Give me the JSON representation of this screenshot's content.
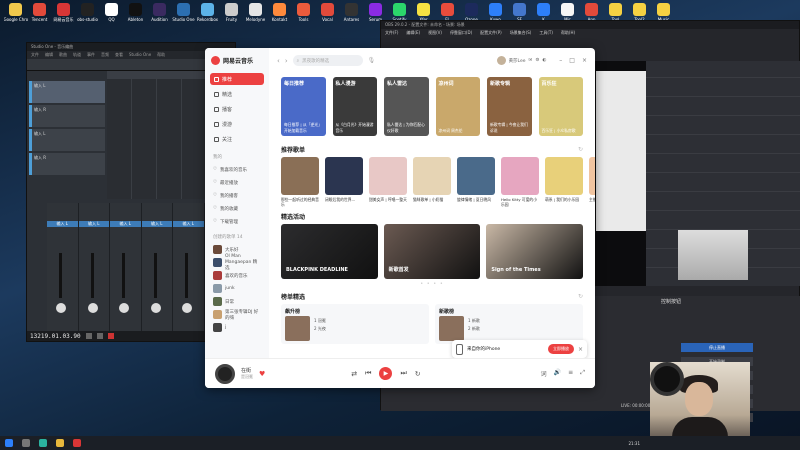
{
  "desktop": {
    "icons": [
      {
        "label": "Google Chrome",
        "color": "#f2c94c"
      },
      {
        "label": "Tencent",
        "color": "#e24a3b"
      },
      {
        "label": "网易云音乐",
        "color": "#d93636"
      },
      {
        "label": "obs-studio",
        "color": "#222222"
      },
      {
        "label": "QQ",
        "color": "#ffffff"
      },
      {
        "label": "Ableton",
        "color": "#111111"
      },
      {
        "label": "Audition",
        "color": "#3a2a60"
      },
      {
        "label": "Studio One",
        "color": "#2c6fb1"
      },
      {
        "label": "Rekordbox",
        "color": "#5cb3e8"
      },
      {
        "label": "Fruity",
        "color": "#cccccc"
      },
      {
        "label": "Melodyne",
        "color": "#e6e6e6"
      },
      {
        "label": "Kontakt",
        "color": "#ff8a3c"
      },
      {
        "label": "Tools",
        "color": "#ec5b3c"
      },
      {
        "label": "Vocal",
        "color": "#e24a3b"
      },
      {
        "label": "Antares",
        "color": "#333333"
      },
      {
        "label": "Serum",
        "color": "#8a2be2"
      },
      {
        "label": "Spotify",
        "color": "#2bd66b"
      },
      {
        "label": "Xfer",
        "color": "#f5e142"
      },
      {
        "label": "FL",
        "color": "#e74c3c"
      },
      {
        "label": "Ozone",
        "color": "#1c2a5c"
      },
      {
        "label": "Kuwo",
        "color": "#2d7ff9"
      },
      {
        "label": "SF",
        "color": "#4477cc"
      },
      {
        "label": "K",
        "color": "#2d7ff9"
      },
      {
        "label": "Mic",
        "color": "#f5f5f5"
      },
      {
        "label": "App",
        "color": "#e24a3b"
      },
      {
        "label": "Tool",
        "color": "#f5d142"
      },
      {
        "label": "Tool2",
        "color": "#f5d142"
      },
      {
        "label": "Music",
        "color": "#f5d142"
      }
    ]
  },
  "daw": {
    "title": "Studio One - 音乐编曲",
    "menu": [
      "文件",
      "编辑",
      "歌曲",
      "轨道",
      "事件",
      "音频",
      "查看",
      "Studio One",
      "帮助"
    ],
    "tracks": [
      "输入 L",
      "输入 R",
      "输入 L",
      "输入 R"
    ],
    "channels": [
      "输入 L",
      "输入 L",
      "输入 L",
      "输入 L",
      "输入 L",
      "输入 L"
    ],
    "timecode": "13219.01.03.90"
  },
  "obs": {
    "title": "OBS 29.0.2 - 配置文件: 未命名 - 场景: 场景",
    "menu": [
      "文件(F)",
      "编辑(E)",
      "视图(V)",
      "停靠窗口(D)",
      "配置文件(P)",
      "场景集合(S)",
      "工具(T)",
      "帮助(H)"
    ],
    "panel_title": "控制按钮",
    "buttons": [
      "停止直播",
      "开始录制",
      "启动虚拟摄像机",
      "工作室模式",
      "设置",
      "退出"
    ],
    "status": "LIVE: 00:00:00"
  },
  "netease": {
    "logo": "网易云音乐",
    "nav": [
      {
        "label": "推荐",
        "active": true
      },
      {
        "label": "精选",
        "active": false
      },
      {
        "label": "播客",
        "active": false
      },
      {
        "label": "漫游",
        "active": false
      },
      {
        "label": "关注",
        "active": false
      }
    ],
    "my_label": "我的",
    "my_items": [
      "我喜欢的音乐",
      "最近播放",
      "我的播客",
      "我的收藏",
      "下载管理"
    ],
    "created_label": "创建的歌单 14",
    "playlists": [
      "大乐好",
      "Ol Man Mangaepan 精选",
      "喜欢的音乐",
      "junk",
      "日常",
      "第三张专辑DJ 好的嗨",
      "j"
    ],
    "search_placeholder": "黑夜歌的精选",
    "user_name": "黄莎Lee",
    "banners": [
      {
        "tag": "每日推荐",
        "sub": "每日推荐 | 从「逆光」开始加载音乐",
        "color": "#4a6ac8"
      },
      {
        "tag": "私人漫游",
        "sub": "从《白月光》开始漫游音乐",
        "color": "#3a3a3a"
      },
      {
        "tag": "私人雷达",
        "sub": "私人雷达 | 为你匹配心仪好歌",
        "color": "#555555"
      },
      {
        "tag": "凉州词",
        "sub": "凉州词 周杰伦",
        "color": "#c9a86b"
      },
      {
        "tag": "新歌专辑",
        "sub": "新歌专辑 | 今夜让我们诉说",
        "color": "#8a6240"
      },
      {
        "tag": "百乐狂",
        "sub": "百乐狂 | 小众私房歌",
        "color": "#d8c97a"
      }
    ],
    "recommend_title": "推荐歌单",
    "recommend_more": "↻",
    "recommend": [
      {
        "name": "那些一起听过的经典音乐",
        "color": "#8a6f56"
      },
      {
        "name": "闭眼后我的世界...",
        "color": "#2b3550"
      },
      {
        "name": "甜美女声 | 哼唱一整天",
        "color": "#e8c8c6"
      },
      {
        "name": "猫咪歌单 | 小奶猫",
        "color": "#e6d4b4"
      },
      {
        "name": "旋律情绪 | 夏日晚风",
        "color": "#4a6a8a"
      },
      {
        "name": "Hello Kitty 可爱的小乐园",
        "color": "#e6a6c0"
      },
      {
        "name": "萌系 | 我们的小乐园",
        "color": "#e8d07a"
      },
      {
        "name": "主推+可爱推荐",
        "color": "#f0c4a0"
      }
    ],
    "featured_title": "精选活动",
    "featured": [
      {
        "name": "BLACKPINK DEADLINE",
        "color": "#2c2c2e"
      },
      {
        "name": "新歌首发",
        "color": "#6b5a52"
      },
      {
        "name": "Sign of the Times",
        "color": "#c9b8a6"
      }
    ],
    "charts_title": "榜单精选",
    "charts": [
      {
        "name": "飙升榜",
        "items": [
          "1 冠冕",
          "2 光夜"
        ]
      },
      {
        "name": "新歌榜",
        "items": [
          "1 新歌",
          "2 新歌"
        ]
      }
    ],
    "iphone_promo": "来自你的iPhone",
    "iphone_btn": "立即播放",
    "player": {
      "song": "在街",
      "artist": "是冠冕",
      "progress": 0.04
    }
  },
  "taskbar": {
    "time": "21:31"
  }
}
